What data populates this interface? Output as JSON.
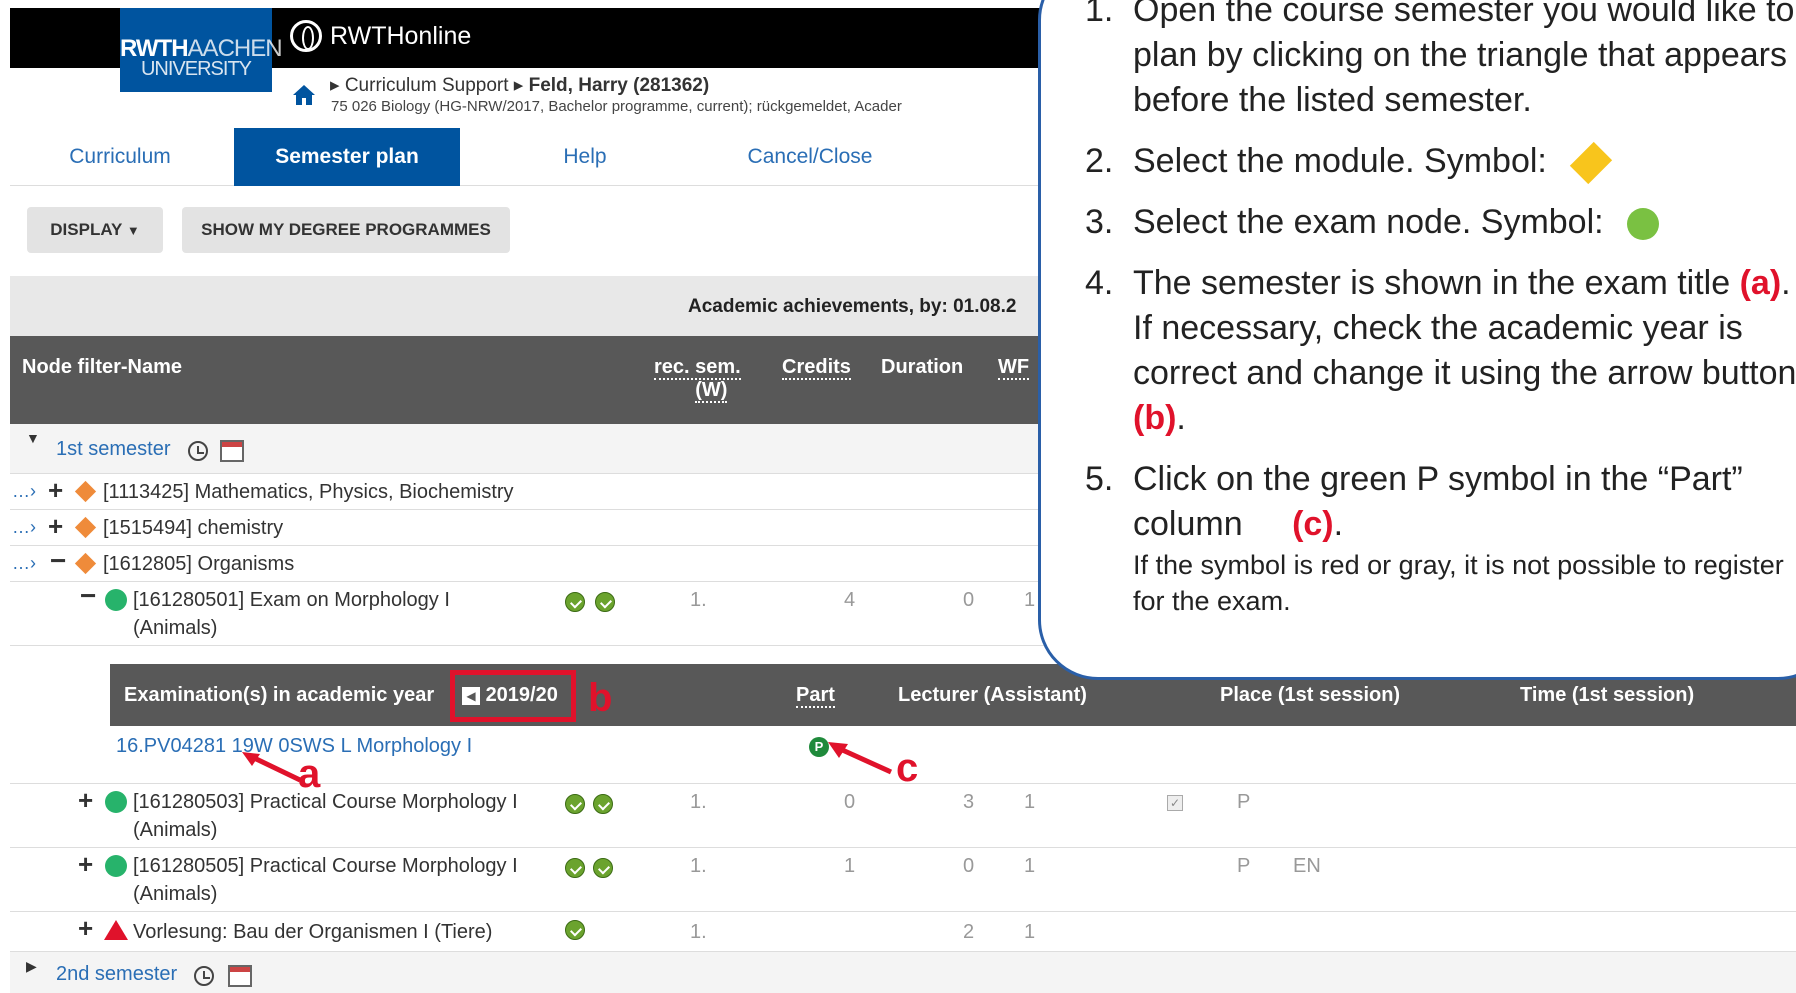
{
  "header": {
    "logo_line1_bold": "RWTH",
    "logo_line1_light": "AACHEN",
    "logo_line2": "UNIVERSITY",
    "app_title": "RWTHonline",
    "breadcrumb_section": "Curriculum Support",
    "breadcrumb_person": "Feld, Harry (281362)",
    "program_line": "75 026 Biology (HG-NRW/2017, Bachelor programme, current); rückgemeldet, Acader"
  },
  "tabs": [
    {
      "label": "Curriculum"
    },
    {
      "label": "Semester plan"
    },
    {
      "label": "Help"
    },
    {
      "label": "Cancel/Close"
    }
  ],
  "toolbar": {
    "display_label": "DISPLAY",
    "degree_label": "SHOW MY DEGREE PROGRAMMES"
  },
  "achievements_label": "Academic achievements, by: 01.08.2",
  "table_header": {
    "name": "Node filter-Name",
    "rec_sem": "rec. sem.",
    "rec_sem_w": "(W)",
    "credits": "Credits",
    "duration": "Duration",
    "wf": "WF"
  },
  "semesters": {
    "first": "1st semester",
    "second": "2nd semester"
  },
  "modules": [
    {
      "name": "[1113425] Mathematics, Physics, Biochemistry"
    },
    {
      "name": "[1515494] chemistry"
    },
    {
      "name": "[1612805] Organisms"
    }
  ],
  "exam_node": {
    "name_line1": "[161280501] Exam on Morphology I",
    "name_line2": "(Animals)",
    "rec_sem": "1.",
    "credits": "4",
    "duration": "0",
    "wf": "1"
  },
  "exam_table": {
    "title": "Examination(s) in academic year",
    "year": "2019/20",
    "part": "Part",
    "lecturer": "Lecturer (Assistant)",
    "place": "Place (1st session)",
    "time": "Time (1st session)",
    "entry": "16.PV04281 19W 0SWS L Morphology I",
    "part_symbol": "P"
  },
  "practicals": [
    {
      "name_line1": "[161280503] Practical Course Morphology I",
      "name_line2": "(Animals)",
      "rec_sem": "1.",
      "credits": "0",
      "duration": "3",
      "wf": "1",
      "extra1": "P",
      "extra2": ""
    },
    {
      "name_line1": "[161280505] Practical Course Morphology I",
      "name_line2": "(Animals)",
      "rec_sem": "1.",
      "credits": "1",
      "duration": "0",
      "wf": "1",
      "extra1": "P",
      "extra2": "EN"
    }
  ],
  "lecture": {
    "name": "Vorlesung: Bau der Organismen I (Tiere)",
    "rec_sem": "1.",
    "duration": "2",
    "wf": "1"
  },
  "instructions": {
    "s1": "Open the course semester you would like to plan by clicking on the triangle that appears before the listed semester.",
    "s2": "Select the module. Symbol:",
    "s3": "Select the exam node. Symbol:",
    "s4a": "The semester is shown in the exam title",
    "s4_ref_a": "(a)",
    "s4b": ". If necessary, check the academic year is correct and change it using the arrow button",
    "s4_ref_b": "(b)",
    "s4c": ".",
    "s5a": "Click on the green P symbol in the “Part” column",
    "s5_ref_c": "(c)",
    "s5b": ".",
    "s5_note": "If the symbol is red or gray, it is not possible to register for the exam."
  },
  "annotations": {
    "a": "a",
    "b": "b",
    "c": "c"
  },
  "colors": {
    "brand_blue": "#00549f",
    "annotation_red": "#e0122b",
    "module_orange": "#ef8b3a",
    "exam_green": "#27b36b"
  }
}
